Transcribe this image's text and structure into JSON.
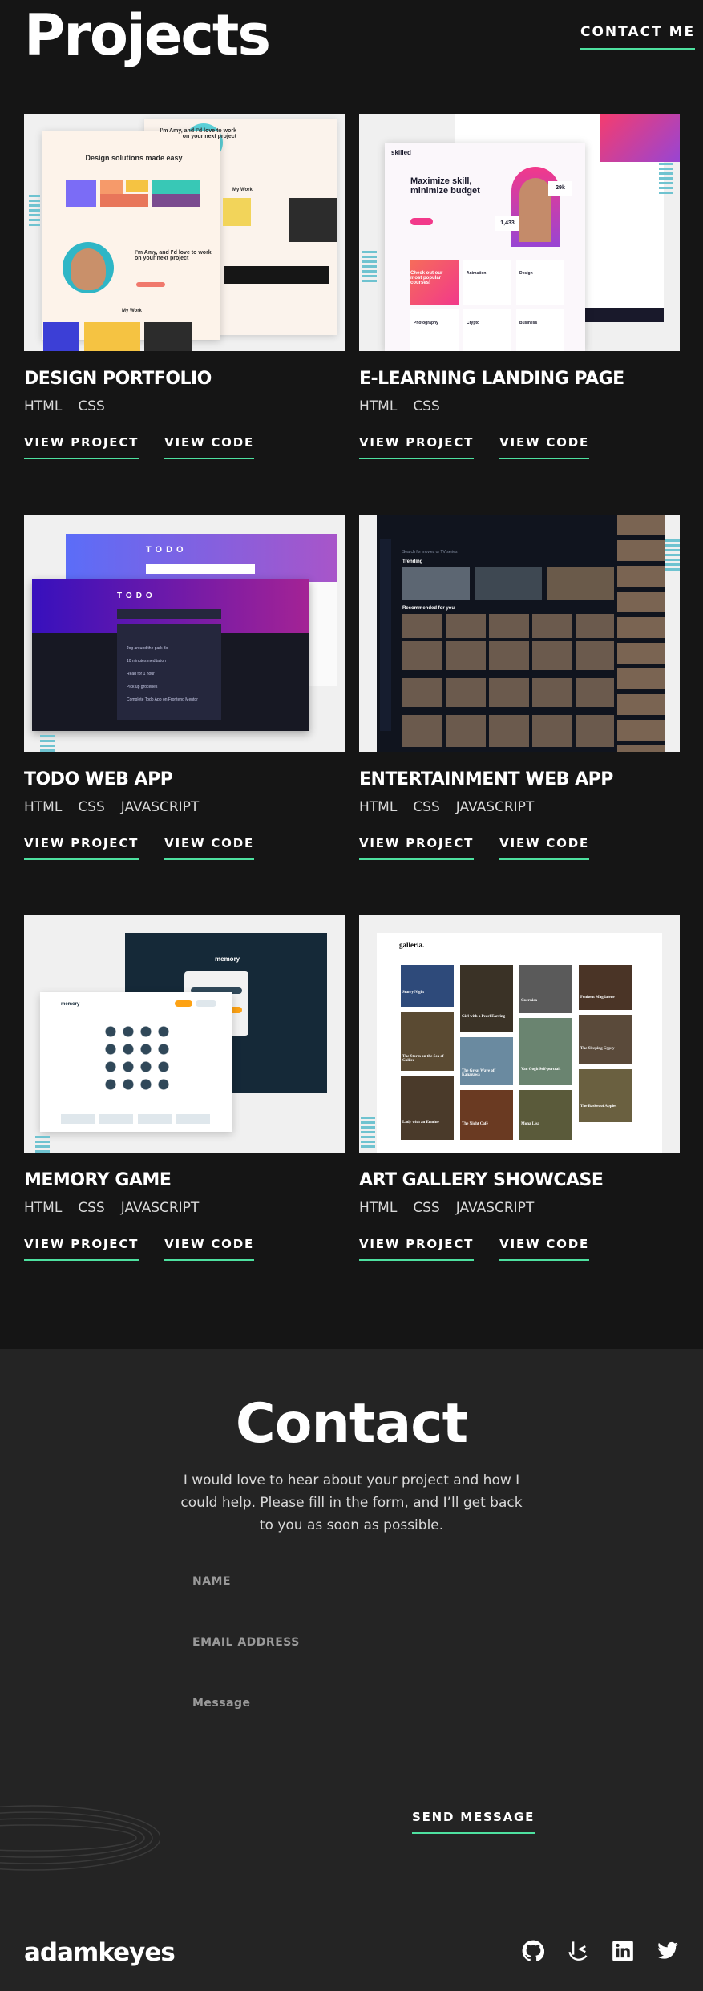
{
  "header": {
    "title": "Projects",
    "contact_link": "CONTACT ME"
  },
  "projects": [
    {
      "title": "DESIGN PORTFOLIO",
      "tags": [
        "HTML",
        "CSS"
      ],
      "view_project": "VIEW PROJECT",
      "view_code": "VIEW CODE",
      "thumb": {
        "headline": "Design solutions made easy",
        "intro": "I’m Amy, and I’d love to work on your next project",
        "section": "My Work"
      }
    },
    {
      "title": "E-LEARNING LANDING PAGE",
      "tags": [
        "HTML",
        "CSS"
      ],
      "view_project": "VIEW PROJECT",
      "view_code": "VIEW CODE",
      "thumb": {
        "brand": "skilled",
        "headline": "Maximize skill, minimize budget",
        "stat1": "29k",
        "stat2": "1,433",
        "cta": "Check out our most popular courses!",
        "courses": [
          "Animation",
          "Design",
          "Photography",
          "Crypto",
          "Business"
        ]
      }
    },
    {
      "title": "TODO WEB APP",
      "tags": [
        "HTML",
        "CSS",
        "JAVASCRIPT"
      ],
      "view_project": "VIEW PROJECT",
      "view_code": "VIEW CODE",
      "thumb": {
        "app_title": "TODO",
        "items": [
          "Jog around the park 3x",
          "10 minutes meditation",
          "Read for 1 hour",
          "Pick up groceries",
          "Complete Todo App on Frontend Mentor"
        ]
      }
    },
    {
      "title": "ENTERTAINMENT WEB APP",
      "tags": [
        "HTML",
        "CSS",
        "JAVASCRIPT"
      ],
      "view_project": "VIEW PROJECT",
      "view_code": "VIEW CODE",
      "thumb": {
        "search": "Search for movies or TV series",
        "trending": "Trending",
        "recommended": "Recommended for you"
      }
    },
    {
      "title": "MEMORY GAME",
      "tags": [
        "HTML",
        "CSS",
        "JAVASCRIPT"
      ],
      "view_project": "VIEW PROJECT",
      "view_code": "VIEW CODE",
      "thumb": {
        "app_title": "memory"
      }
    },
    {
      "title": "ART GALLERY SHOWCASE",
      "tags": [
        "HTML",
        "CSS",
        "JAVASCRIPT"
      ],
      "view_project": "VIEW PROJECT",
      "view_code": "VIEW CODE",
      "thumb": {
        "brand": "galleria.",
        "artworks": [
          "Starry Night",
          "Girl with a Pearl Earring",
          "Guernica",
          "Penitent Magdalene",
          "The Storm on the Sea of Galilee",
          "The Great Wave off Kanagawa",
          "Van Gogh Self-portrait",
          "The Sleeping Gypsy",
          "Lady with an Ermine",
          "The Night Café",
          "Mona Lisa",
          "The Basket of Apples"
        ]
      }
    }
  ],
  "contact": {
    "title": "Contact",
    "description": "I would love to hear about your project and how I could help. Please fill in the form, and I’ll get back to you as soon as possible.",
    "name_placeholder": "NAME",
    "email_placeholder": "EMAIL ADDRESS",
    "message_placeholder": "Message",
    "send_label": "SEND MESSAGE"
  },
  "footer": {
    "logo": "adamkeyes",
    "socials": [
      "github-icon",
      "frontend-mentor-icon",
      "linkedin-icon",
      "twitter-icon"
    ]
  },
  "colors": {
    "background": "#151515",
    "section": "#242424",
    "accent": "#4ee1a0",
    "text": "#ffffff"
  }
}
